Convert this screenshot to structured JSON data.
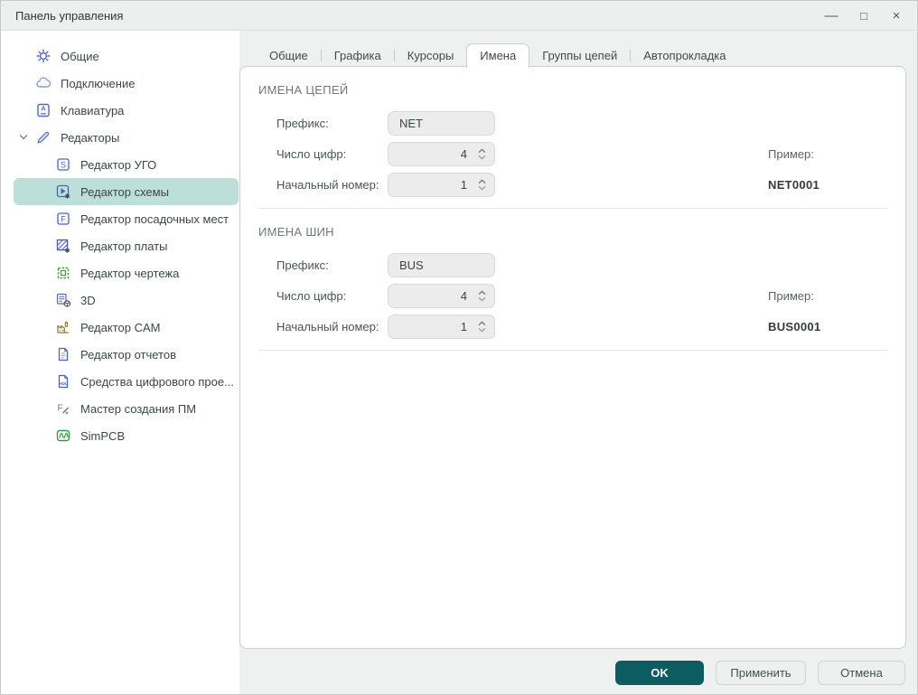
{
  "window": {
    "title": "Панель управления",
    "controls": {
      "minimize_glyph": "—",
      "maximize_glyph": "□",
      "close_glyph": "×"
    }
  },
  "sidebar": {
    "items": [
      {
        "label": "Общие",
        "icon": "gear-icon",
        "level": 0,
        "selected": false
      },
      {
        "label": "Подключение",
        "icon": "cloud-icon",
        "level": 0,
        "selected": false
      },
      {
        "label": "Клавиатура",
        "icon": "keyboard-icon",
        "level": 0,
        "selected": false
      },
      {
        "label": "Редакторы",
        "icon": "pencil-icon",
        "level": 0,
        "expanded": true,
        "selected": false
      },
      {
        "label": "Редактор УГО",
        "icon": "symbol-editor-icon",
        "level": 1,
        "selected": false
      },
      {
        "label": "Редактор схемы",
        "icon": "schematic-editor-icon",
        "level": 1,
        "selected": true
      },
      {
        "label": "Редактор посадочных мест",
        "icon": "footprint-editor-icon",
        "level": 1,
        "selected": false
      },
      {
        "label": "Редактор платы",
        "icon": "board-editor-icon",
        "level": 1,
        "selected": false
      },
      {
        "label": "Редактор чертежа",
        "icon": "drawing-editor-icon",
        "level": 1,
        "selected": false
      },
      {
        "label": "3D",
        "icon": "3d-icon",
        "level": 1,
        "selected": false
      },
      {
        "label": "Редактор CAM",
        "icon": "cam-editor-icon",
        "level": 1,
        "selected": false
      },
      {
        "label": "Редактор отчетов",
        "icon": "report-editor-icon",
        "level": 1,
        "selected": false
      },
      {
        "label": "Средства цифрового прое...",
        "icon": "hdl-icon",
        "level": 1,
        "selected": false
      },
      {
        "label": "Мастер создания ПМ",
        "icon": "wizard-icon",
        "level": 1,
        "selected": false
      },
      {
        "label": "SimPCB",
        "icon": "simpcb-icon",
        "level": 1,
        "selected": false
      }
    ]
  },
  "tabs": [
    {
      "label": "Общие",
      "active": false
    },
    {
      "label": "Графика",
      "active": false
    },
    {
      "label": "Курсоры",
      "active": false
    },
    {
      "label": "Имена",
      "active": true
    },
    {
      "label": "Группы цепей",
      "active": false
    },
    {
      "label": "Автопрокладка",
      "active": false
    }
  ],
  "sections": [
    {
      "title": "ИМЕНА ЦЕПЕЙ",
      "fields": [
        {
          "label": "Префикс:",
          "value": "NET",
          "type": "text"
        },
        {
          "label": "Число цифр:",
          "value": "4",
          "type": "spinner"
        },
        {
          "label": "Начальный номер:",
          "value": "1",
          "type": "spinner"
        }
      ],
      "example_label": "Пример:",
      "example_value": "NET0001"
    },
    {
      "title": "ИМЕНА ШИН",
      "fields": [
        {
          "label": "Префикс:",
          "value": "BUS",
          "type": "text"
        },
        {
          "label": "Число цифр:",
          "value": "4",
          "type": "spinner"
        },
        {
          "label": "Начальный номер:",
          "value": "1",
          "type": "spinner"
        }
      ],
      "example_label": "Пример:",
      "example_value": "BUS0001"
    }
  ],
  "footer": {
    "ok_label": "OK",
    "apply_label": "Применить",
    "cancel_label": "Отмена"
  },
  "colors": {
    "accent_teal": "#0d5c62",
    "selection_teal": "#bcdfda",
    "titlebar_bg": "#edefee",
    "content_bg": "#eff1f0",
    "panel_border": "#cbcfce",
    "input_bg": "#ececec",
    "icon_blue": "#4a5fd6",
    "icon_green": "#2f9a3f",
    "icon_olive": "#8c7d2a"
  }
}
